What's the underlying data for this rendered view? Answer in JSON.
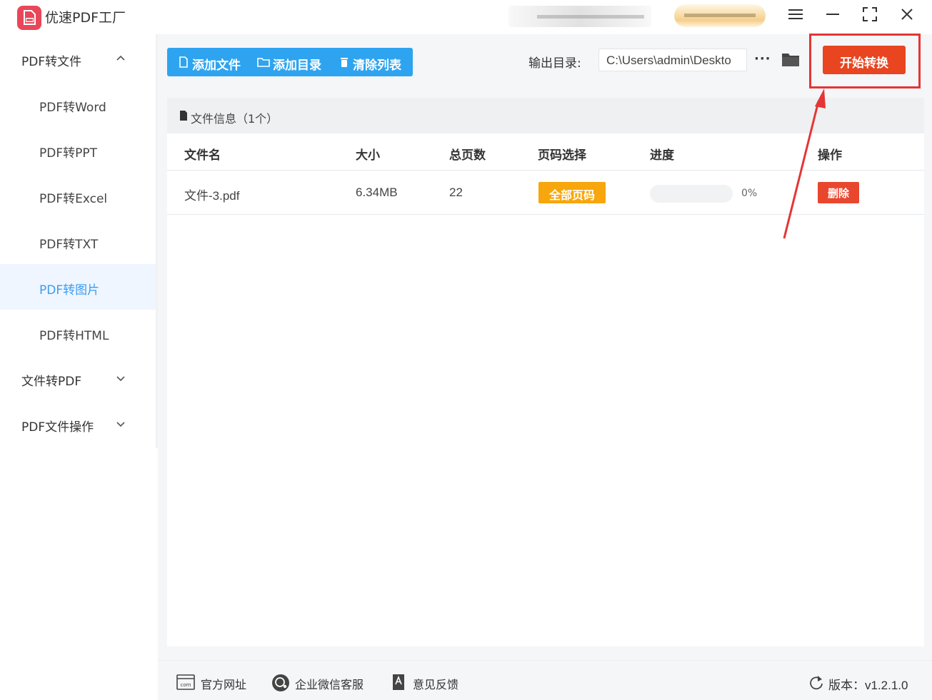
{
  "app": {
    "title": "优速PDF工厂"
  },
  "sidebar": {
    "groups": [
      {
        "label": "PDF转文件",
        "expanded": true
      },
      {
        "label": "文件转PDF",
        "expanded": false
      },
      {
        "label": "PDF文件操作",
        "expanded": false
      }
    ],
    "items": [
      {
        "label": "PDF转Word"
      },
      {
        "label": "PDF转PPT"
      },
      {
        "label": "PDF转Excel"
      },
      {
        "label": "PDF转TXT"
      },
      {
        "label": "PDF转图片",
        "active": true
      },
      {
        "label": "PDF转HTML"
      }
    ]
  },
  "toolbar": {
    "add_file": "添加文件",
    "add_dir": "添加目录",
    "clear_list": "清除列表",
    "output_label": "输出目录:",
    "output_path": "C:\\Users\\admin\\Deskto",
    "more": "···",
    "start": "开始转换"
  },
  "file_panel": {
    "header": "文件信息（1个）",
    "columns": [
      "文件名",
      "大小",
      "总页数",
      "页码选择",
      "进度",
      "操作"
    ],
    "rows": [
      {
        "name": "文件-3.pdf",
        "size": "6.34MB",
        "pages": "22",
        "page_select": "全部页码",
        "progress": 0,
        "progress_text": "0%",
        "action": "删除"
      }
    ]
  },
  "footer": {
    "website": "官方网址",
    "wechat": "企业微信客服",
    "feedback": "意见反馈",
    "version": "版本：v1.2.1.0"
  },
  "colors": {
    "primary": "#2ea4f0",
    "start_button": "#e84520",
    "badge_orange": "#f7a60d",
    "delete_red": "#e8472e",
    "annotation_red": "#e53535",
    "sidebar_active": "#3b9cf0"
  },
  "icons": [
    "app-logo-icon",
    "menu-icon",
    "minimize-icon",
    "maximize-icon",
    "close-icon",
    "file-icon",
    "folder-outline-icon",
    "trash-icon",
    "more-icon",
    "folder-icon",
    "document-icon",
    "website-icon",
    "wechat-icon",
    "feedback-icon",
    "refresh-icon",
    "chevron-up-icon",
    "chevron-down-icon",
    "annotation-arrow"
  ]
}
